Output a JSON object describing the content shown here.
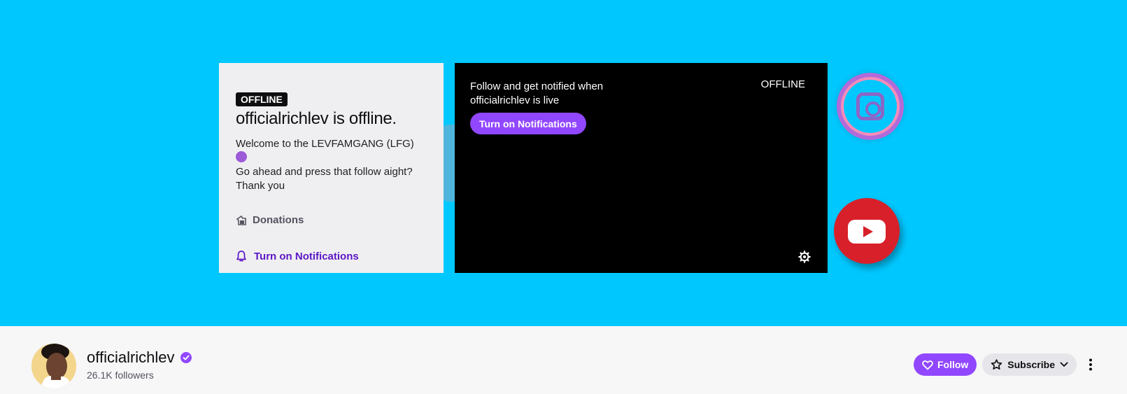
{
  "info_panel": {
    "badge": "OFFLINE",
    "title": "officialrichlev is offline.",
    "welcome_line1": "Welcome to the LEVFAMGANG (LFG)",
    "welcome_line2": "Go ahead and press that follow aight?",
    "welcome_line3": "Thank you",
    "donations_label": "Donations",
    "notifications_label": "Turn on Notifications"
  },
  "player": {
    "message": "Follow and get notified when officialrichlev is live",
    "notifications_button": "Turn on Notifications",
    "status": "OFFLINE"
  },
  "channel": {
    "name": "officialrichlev",
    "followers": "26.1K followers",
    "follow_label": "Follow",
    "subscribe_label": "Subscribe"
  },
  "colors": {
    "banner": "#00c8ff",
    "accent": "#9147ff",
    "link": "#5c16c5"
  }
}
